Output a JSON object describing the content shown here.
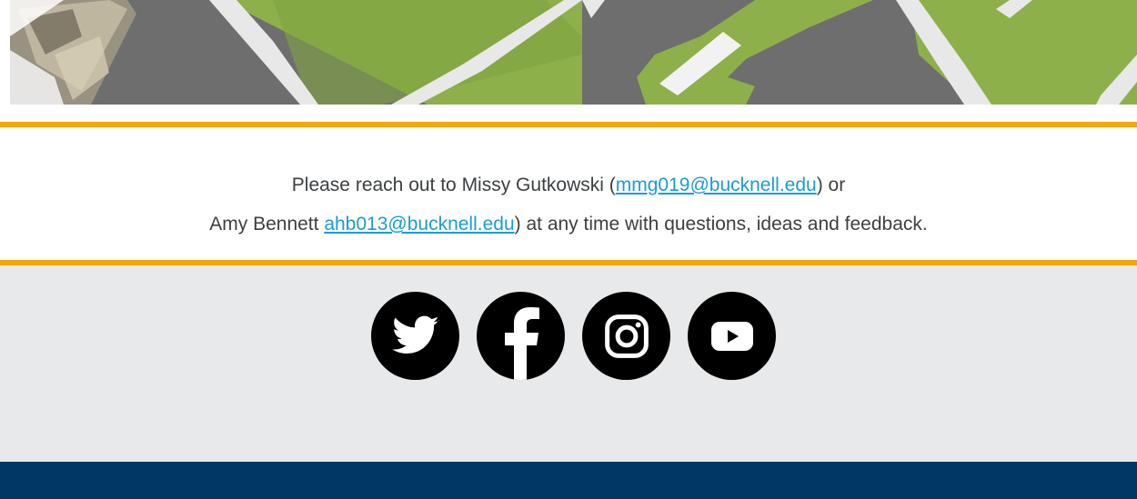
{
  "contact": {
    "line1_prefix": "Please reach out to Missy Gutkowski (",
    "email1": "mmg019@bucknell.edu",
    "line1_suffix": ") or",
    "line2_prefix": "Amy Bennett ",
    "email2": "ahb013@bucknell.edu",
    "line2_suffix": ") at any time with questions, ideas and feedback."
  },
  "social": {
    "icons": [
      "twitter-icon",
      "facebook-icon",
      "instagram-icon",
      "youtube-icon"
    ]
  },
  "colors": {
    "accent_rule": "#f5a700",
    "link": "#1a9cd8",
    "footer_band": "#003865",
    "social_band": "#e8e9ea"
  }
}
